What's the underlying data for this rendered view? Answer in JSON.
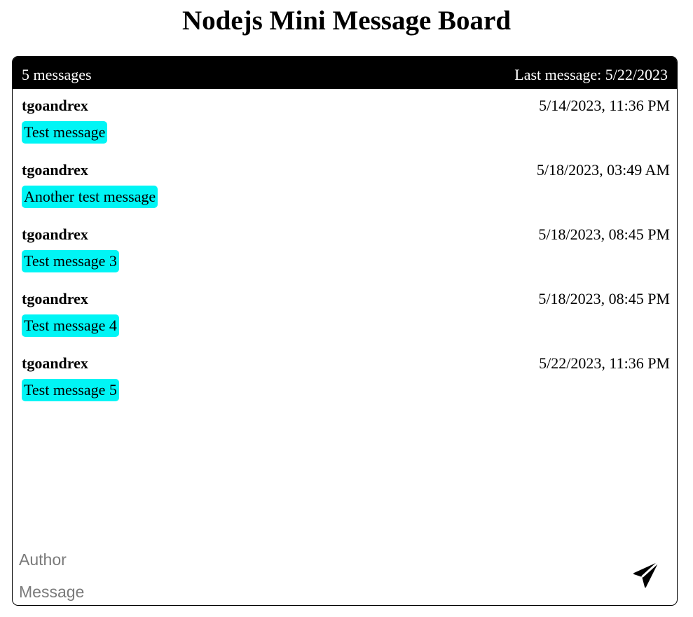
{
  "page": {
    "title": "Nodejs Mini Message Board"
  },
  "header": {
    "count_label": "5 messages",
    "last_message_label": "Last message: 5/22/2023"
  },
  "messages": [
    {
      "author": "tgoandrex",
      "date": "5/14/2023, 11:36 PM",
      "text": "Test message"
    },
    {
      "author": "tgoandrex",
      "date": "5/18/2023, 03:49 AM",
      "text": "Another test message"
    },
    {
      "author": "tgoandrex",
      "date": "5/18/2023, 08:45 PM",
      "text": "Test message 3"
    },
    {
      "author": "tgoandrex",
      "date": "5/18/2023, 08:45 PM",
      "text": "Test message 4"
    },
    {
      "author": "tgoandrex",
      "date": "5/22/2023, 11:36 PM",
      "text": "Test message 5"
    }
  ],
  "form": {
    "author_value": "",
    "author_placeholder": "Author",
    "message_value": "",
    "message_placeholder": "Message",
    "send_icon": "paper-plane-icon"
  },
  "colors": {
    "header_bg": "#000000",
    "message_highlight": "#00f5f5"
  }
}
